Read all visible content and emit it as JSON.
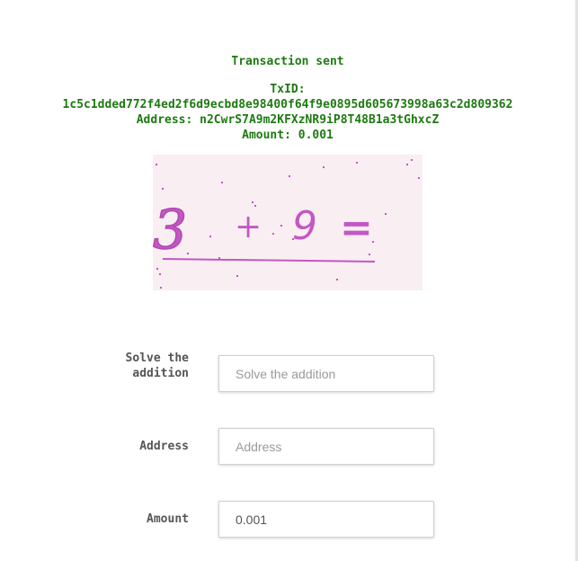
{
  "result": {
    "title": "Transaction sent",
    "txid_label": "TxID:",
    "txid_value": "1c5c1dded772f4ed2f6d9ecbd8e98400f64f9e0895d605673998a63c2d809362",
    "address_line": "Address: n2CwrS7A9m2KFXzNR9iP8T48B1a3tGhxcZ",
    "amount_line": "Amount: 0.001"
  },
  "captcha": {
    "text": "3 + 9 =",
    "first": "3",
    "operator": "+",
    "second": "9",
    "equals": "=",
    "ink_color": "#c457c4",
    "background_color": "#f9eef2"
  },
  "form": {
    "captcha_label": "Solve the addition",
    "captcha_placeholder": "Solve the addition",
    "captcha_value": "",
    "address_label": "Address",
    "address_placeholder": "Address",
    "address_value": "",
    "amount_label": "Amount",
    "amount_placeholder": "",
    "amount_value": "0.001"
  },
  "colors": {
    "success_text": "#1e7a12",
    "label_text": "#555555",
    "input_border": "#cfcfcf"
  }
}
